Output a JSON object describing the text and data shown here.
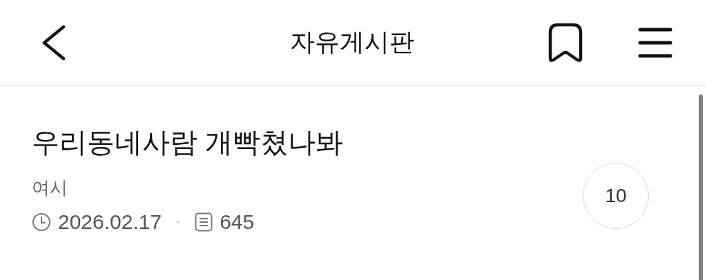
{
  "header": {
    "title": "자유게시판"
  },
  "post": {
    "title": "우리동네사람 개빡쳤나봐",
    "author": "여시",
    "date": "2026.02.17",
    "views": "645",
    "comment_count": "10"
  }
}
